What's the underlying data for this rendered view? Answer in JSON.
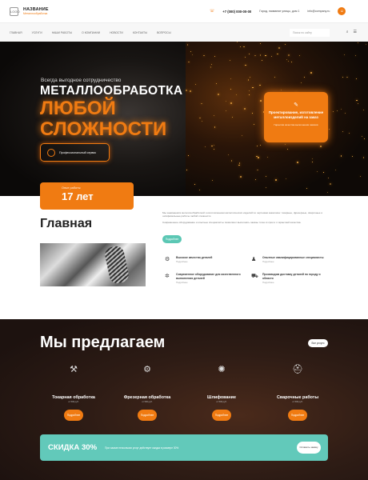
{
  "header": {
    "logo_badge": "LOGO",
    "logo_title": "НАЗВАНИЕ",
    "logo_sub": "Металлообработка",
    "phone": "+7 (000) 000-00-00",
    "address": "Город, название улицы, дом 1",
    "email": "info@company.ru",
    "phone_icon": "phone-icon",
    "profile_icon": "user-icon"
  },
  "nav": {
    "items": [
      "Главная",
      "Услуги",
      "Наши работы",
      "О компании",
      "Новости",
      "Контакты",
      "Вопросы"
    ],
    "search_placeholder": "Поиск по сайту"
  },
  "hero": {
    "kicker": "Всегда выгодное сотрудничество",
    "title": "МЕТАЛЛООБРАБОТКА",
    "accent_line1": "ЛЮБОЙ",
    "accent_line2": "СЛОЖНОСТИ",
    "service_label": "Профессиональный сервис",
    "promo_title": "Проектирование, изготовление металлоизделий на заказ",
    "promo_sub": "Гарантия качества выполнения заказов",
    "years_label": "Опыт работы",
    "years_value": "17 лет"
  },
  "main": {
    "title": "Главная",
    "paragraph1": "Мы занимаемся металлообработкой и изготовлением металлических изделий по чертежам заказчика: токарные, фрезерные, сварочные и шлифовальные работы любой сложности.",
    "paragraph2": "Современное оборудование и опытные специалисты позволяют выполнять заказы точно в срок и с гарантией качества.",
    "more_btn": "Подробнее",
    "features": [
      {
        "icon": "gears-icon",
        "title": "Высокое качество деталей",
        "sub": "Подробнее"
      },
      {
        "icon": "worker-icon",
        "title": "Опытные квалифицированные специалисты",
        "sub": "Подробнее"
      },
      {
        "icon": "gear-icon",
        "title": "Современное оборудование для качественного выполнения деталей",
        "sub": "Подробнее"
      },
      {
        "icon": "truck-icon",
        "title": "Производим доставку деталей по городу и области",
        "sub": "Подробнее"
      }
    ]
  },
  "services": {
    "title": "Мы предлагаем",
    "all_btn": "Все услуги",
    "items": [
      {
        "icon": "lathe-icon",
        "title": "Токарная обработка",
        "sub": "от 500 руб.",
        "btn": "Подробнее"
      },
      {
        "icon": "milling-icon",
        "title": "Фрезерная обработка",
        "sub": "от 500 руб.",
        "btn": "Подробнее"
      },
      {
        "icon": "grinding-icon",
        "title": "Шлифование",
        "sub": "от 500 руб.",
        "btn": "Подробнее"
      },
      {
        "icon": "welding-mask-icon",
        "title": "Сварочные работы",
        "sub": "от 500 руб.",
        "btn": "Подробнее"
      }
    ]
  },
  "discount": {
    "title": "СКИДКА 30%",
    "text": "При заказе нескольких услуг действует скидка в размере 30%",
    "btn": "Оставить заявку"
  },
  "colors": {
    "accent": "#f07b12",
    "teal": "#5bc7b4",
    "dark": "#2e1c15"
  }
}
